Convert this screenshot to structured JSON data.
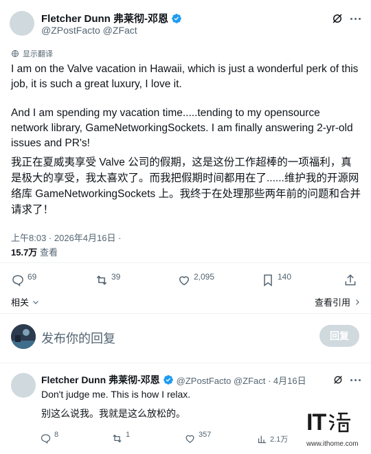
{
  "main_tweet": {
    "author_name": "Fletcher Dunn 弗莱彻-邓恩",
    "author_handles": "@ZPostFacto @ZFact",
    "translate_label": "显示翻译",
    "paragraph_1": "I am on the Valve vacation in Hawaii, which is just a wonderful perk of this job, it is such a great luxury, I love it.",
    "paragraph_2": "And I am spending my vacation time.....tending to my opensource network library, GameNetworkingSockets.  I am finally answering 2-yr-old issues and PR's!",
    "translation": "我正在夏威夷享受 Valve 公司的假期，这是这份工作超棒的一项福利，真是极大的享受，我太喜欢了。而我把假期时间都用在了......维护我的开源网络库 GameNetworkingSockets 上。我终于在处理那些两年前的问题和合并请求了！",
    "timestamp": "上午8:03 · 2026年4月16日 ·",
    "views_count": "15.7万",
    "views_label": "查看",
    "replies": "69",
    "retweets": "39",
    "likes": "2,095",
    "bookmarks": "140",
    "related_label": "相关",
    "quotes_label": "查看引用"
  },
  "reply_box": {
    "placeholder": "发布你的回复",
    "button_label": "回复"
  },
  "reply_tweet": {
    "author_name": "Fletcher Dunn 弗莱彻-邓恩",
    "author_handles": "@ZPostFacto @ZFact · 4月16日",
    "text": "Don't judge me.  This is how I relax.",
    "translation": "别这么说我。我就是这么放松的。",
    "replies": "8",
    "retweets": "1",
    "likes": "357",
    "views": "2.1万"
  },
  "watermark": {
    "logo": "IT之家",
    "url": "www.ithome.com"
  },
  "colors": {
    "verified": "#1d9bf0",
    "secondary_text": "#536471",
    "reply_button": "#cfd9de"
  }
}
